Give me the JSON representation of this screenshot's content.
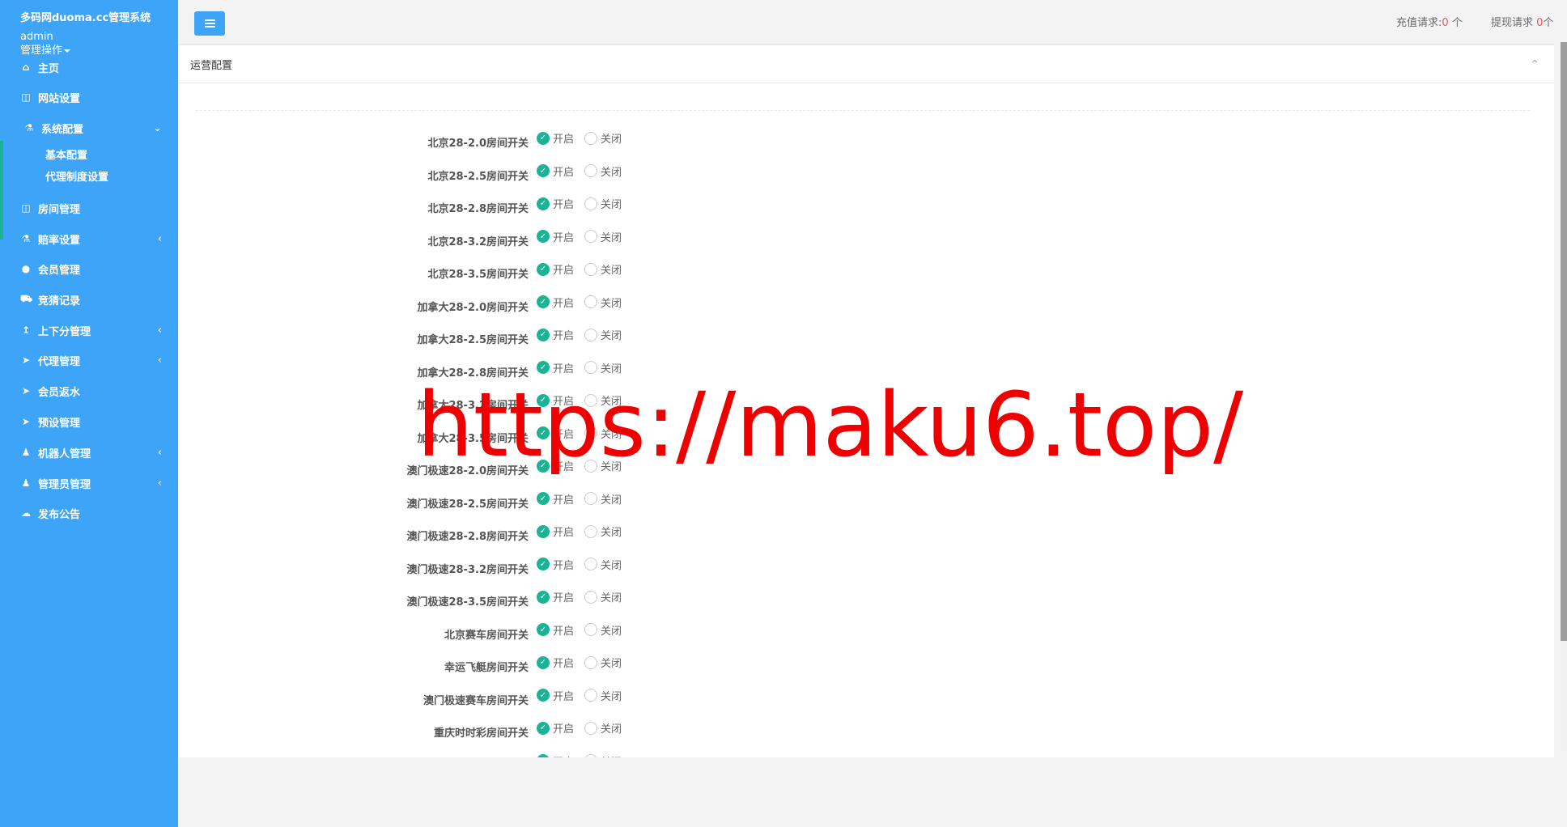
{
  "sidebar": {
    "site_title": "多码网duoma.cc管理系统",
    "username": "admin",
    "user_menu": "管理操作",
    "items": [
      {
        "label": "主页",
        "icon": "home-icon"
      },
      {
        "label": "网站设置",
        "icon": "columns-icon"
      },
      {
        "label": "系统配置",
        "icon": "flask-icon"
      },
      {
        "label": "房间管理",
        "icon": "columns-icon"
      },
      {
        "label": "赔率设置",
        "icon": "flask-icon"
      },
      {
        "label": "会员管理",
        "icon": "user-icon"
      },
      {
        "label": "竞猜记录",
        "icon": "car-icon"
      },
      {
        "label": "上下分管理",
        "icon": "level-up-icon"
      },
      {
        "label": "代理管理",
        "icon": "paper-plane-icon"
      },
      {
        "label": "会员返水",
        "icon": "paper-plane-icon"
      },
      {
        "label": "预设管理",
        "icon": "paper-plane-icon"
      },
      {
        "label": "机器人管理",
        "icon": "male-icon"
      },
      {
        "label": "管理员管理",
        "icon": "male-icon"
      },
      {
        "label": "发布公告",
        "icon": "comment-icon"
      }
    ],
    "sub_items": [
      {
        "label": "基本配置"
      },
      {
        "label": "代理制度设置"
      }
    ]
  },
  "topbar": {
    "recharge_label": "充值请求:",
    "recharge_count": "0",
    "withdraw_label": "提现请求",
    "withdraw_count": "0",
    "unit": "个"
  },
  "panel": {
    "title": "运营配置",
    "on_label": "开启",
    "off_label": "关闭",
    "rows": [
      {
        "label": "北京28-2.0房间开关",
        "state": "on"
      },
      {
        "label": "北京28-2.5房间开关",
        "state": "on"
      },
      {
        "label": "北京28-2.8房间开关",
        "state": "on"
      },
      {
        "label": "北京28-3.2房间开关",
        "state": "on"
      },
      {
        "label": "北京28-3.5房间开关",
        "state": "on"
      },
      {
        "label": "加拿大28-2.0房间开关",
        "state": "on"
      },
      {
        "label": "加拿大28-2.5房间开关",
        "state": "on"
      },
      {
        "label": "加拿大28-2.8房间开关",
        "state": "on"
      },
      {
        "label": "加拿大28-3.2房间开关",
        "state": "on"
      },
      {
        "label": "加拿大28-3.5房间开关",
        "state": "on"
      },
      {
        "label": "澳门极速28-2.0房间开关",
        "state": "on"
      },
      {
        "label": "澳门极速28-2.5房间开关",
        "state": "on"
      },
      {
        "label": "澳门极速28-2.8房间开关",
        "state": "on"
      },
      {
        "label": "澳门极速28-3.2房间开关",
        "state": "on"
      },
      {
        "label": "澳门极速28-3.5房间开关",
        "state": "on"
      },
      {
        "label": "北京赛车房间开关",
        "state": "on"
      },
      {
        "label": "幸运飞艇房间开关",
        "state": "on"
      },
      {
        "label": "澳门极速赛车房间开关",
        "state": "on"
      },
      {
        "label": "重庆时时彩房间开关",
        "state": "on"
      },
      {
        "label": "",
        "state": "on"
      }
    ]
  },
  "watermark": "https://maku6.top/",
  "colors": {
    "sidebar": "#3da4f7",
    "accent": "#1ab394",
    "danger": "#ed5565",
    "watermark": "#ee0000"
  }
}
